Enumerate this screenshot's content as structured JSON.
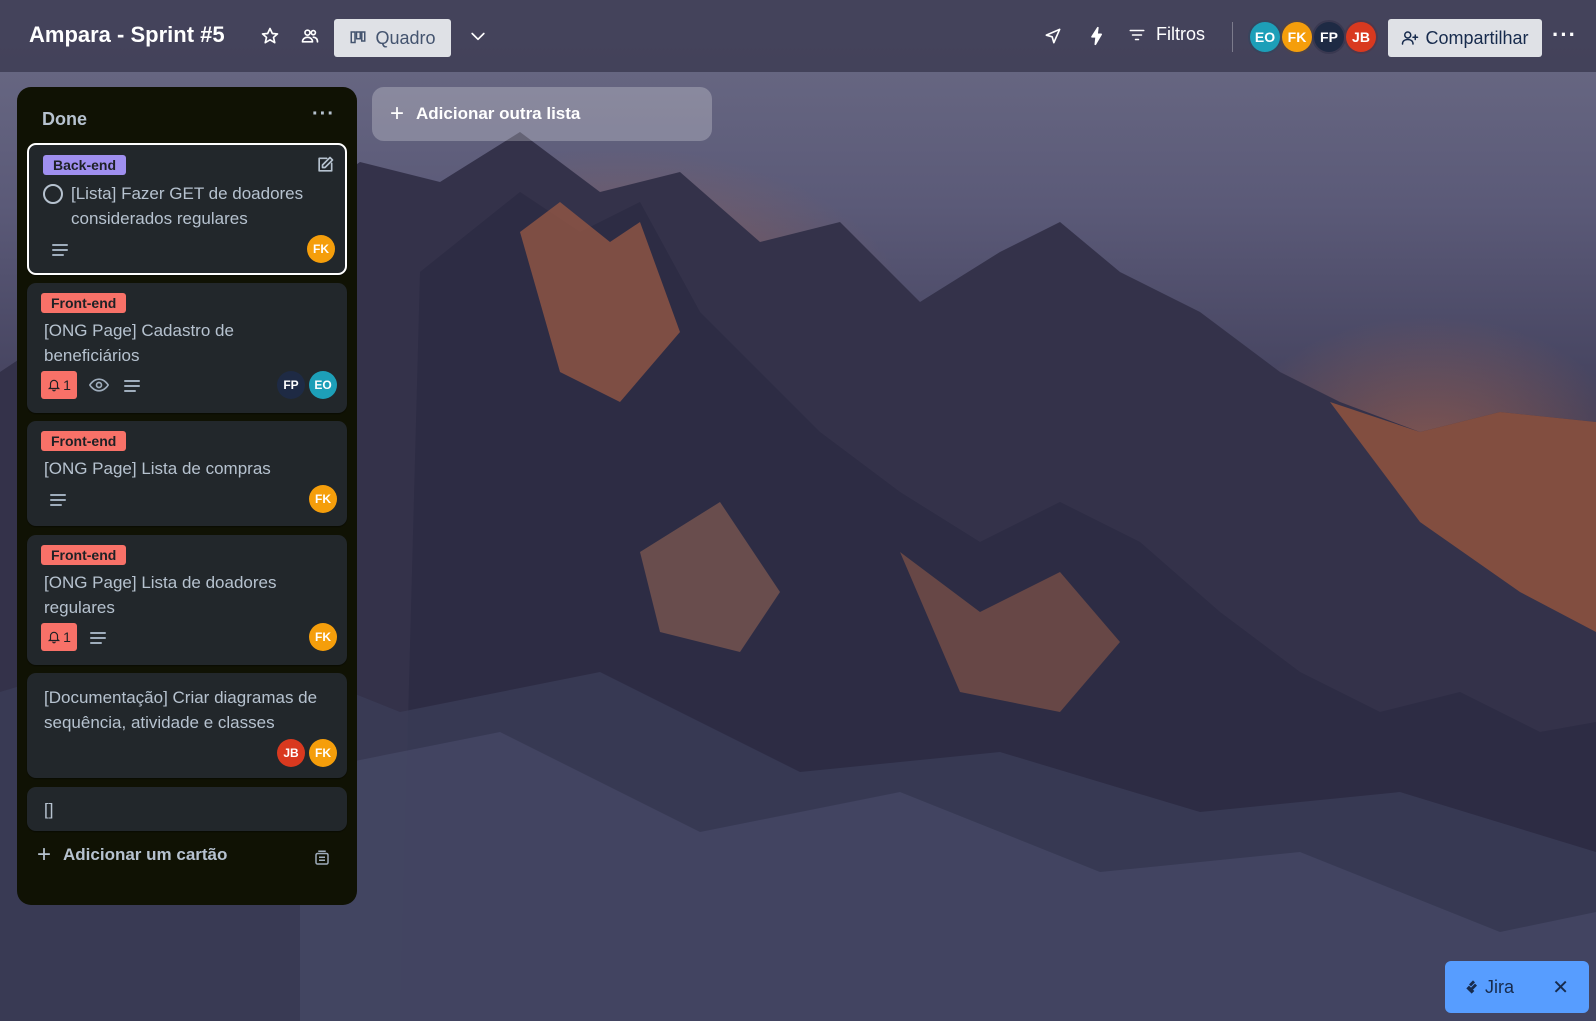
{
  "header": {
    "board_title": "Ampara - Sprint #5",
    "view_label": "Quadro",
    "filters_label": "Filtros",
    "share_label": "Compartilhar",
    "more": "···",
    "members": [
      {
        "initials": "EO",
        "color": "#1d9fb8"
      },
      {
        "initials": "FK",
        "color": "#f59e0b"
      },
      {
        "initials": "FP",
        "color": "#1e2a44"
      },
      {
        "initials": "JB",
        "color": "#d9391f"
      }
    ]
  },
  "list": {
    "title": "Done",
    "more": "···",
    "add_card_label": "Adicionar um cartão",
    "cards": [
      {
        "label": "Back-end",
        "label_color": "#9f8fef",
        "title": "[Lista] Fazer GET de doadores considerados regulares",
        "members": [
          "FK"
        ]
      },
      {
        "label": "Front-end",
        "label_color": "#f87168",
        "title": "[ONG Page] Cadastro de beneficiários",
        "notifications": "1",
        "members": [
          "FP",
          "EO"
        ]
      },
      {
        "label": "Front-end",
        "label_color": "#f87168",
        "title": "[ONG Page] Lista de compras",
        "members": [
          "FK"
        ]
      },
      {
        "label": "Front-end",
        "label_color": "#f87168",
        "title": "[ONG Page] Lista de doadores regulares",
        "notifications": "1",
        "members": [
          "FK"
        ]
      },
      {
        "title": "[Documentação] Criar diagramas de sequência, atividade e classes",
        "members": [
          "JB",
          "FK"
        ]
      },
      {
        "title": "[]"
      }
    ]
  },
  "add_list_label": "Adicionar outra lista",
  "jira": {
    "label": "Jira",
    "close": "✕"
  },
  "colors": {
    "FK": "#f59e0b",
    "FP": "#1e2a44",
    "EO": "#1d9fb8",
    "JB": "#d9391f"
  }
}
